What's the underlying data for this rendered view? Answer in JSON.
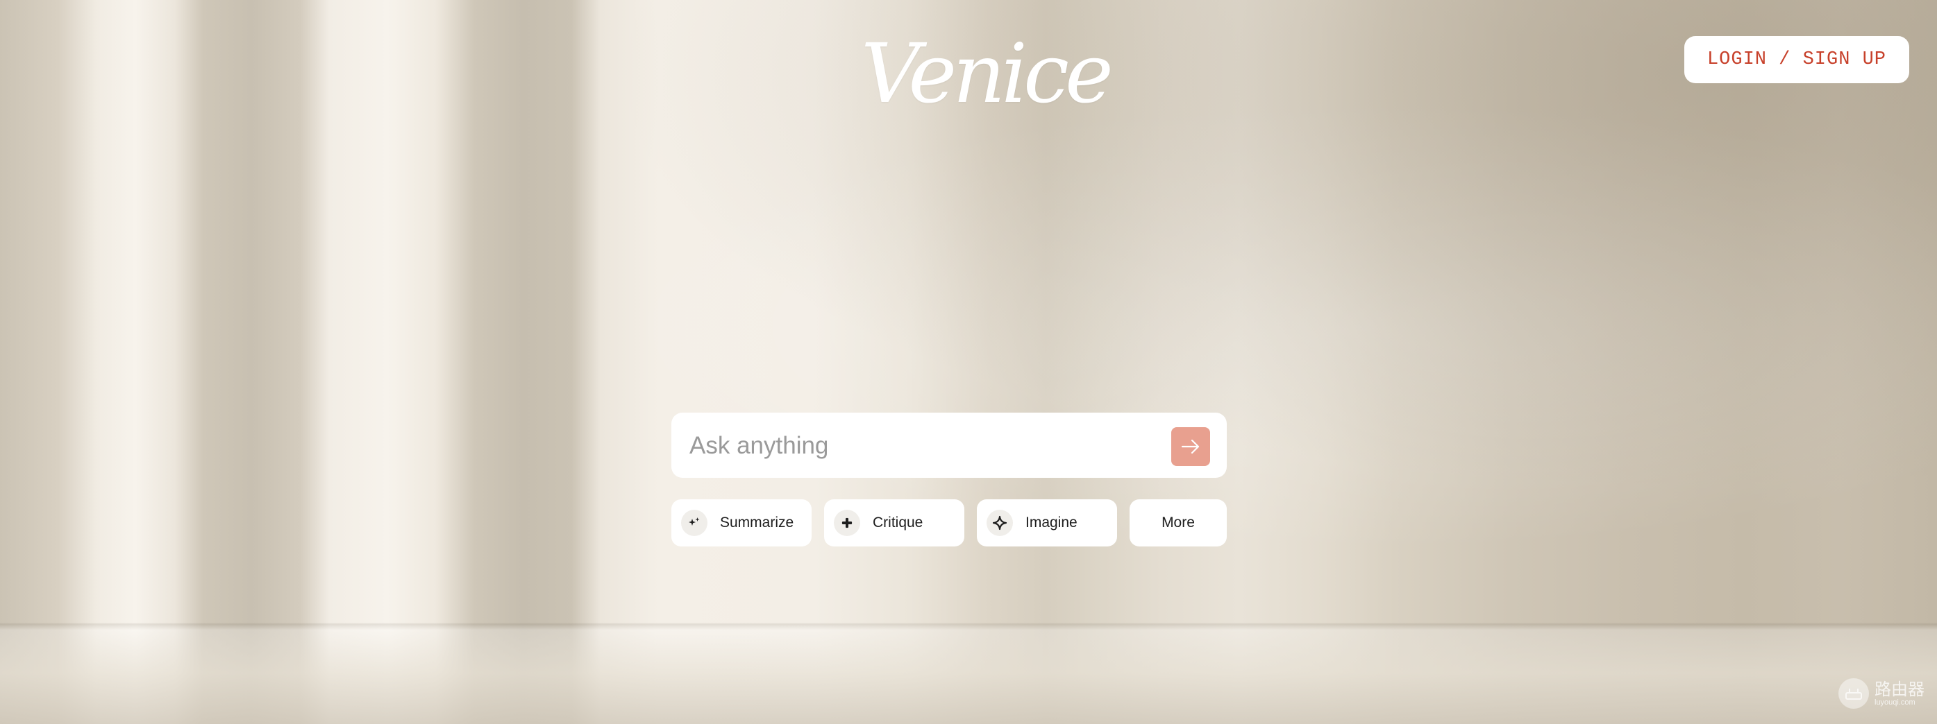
{
  "brand": {
    "logo_text": "Venice"
  },
  "header": {
    "login_label": "LOGIN / SIGN UP"
  },
  "search": {
    "placeholder": "Ask anything",
    "value": "",
    "send_icon": "arrow-right-icon"
  },
  "chips": [
    {
      "label": "Summarize",
      "icon": "sparkle-icon"
    },
    {
      "label": "Critique",
      "icon": "plus-cross-icon"
    },
    {
      "label": "Imagine",
      "icon": "diamond-star-icon"
    },
    {
      "label": "More"
    }
  ],
  "watermark": {
    "main": "路由器",
    "sub": "luyouqi.com"
  },
  "colors": {
    "accent": "#c7402a",
    "send_button": "#e8a08f",
    "surface": "#ffffff"
  }
}
